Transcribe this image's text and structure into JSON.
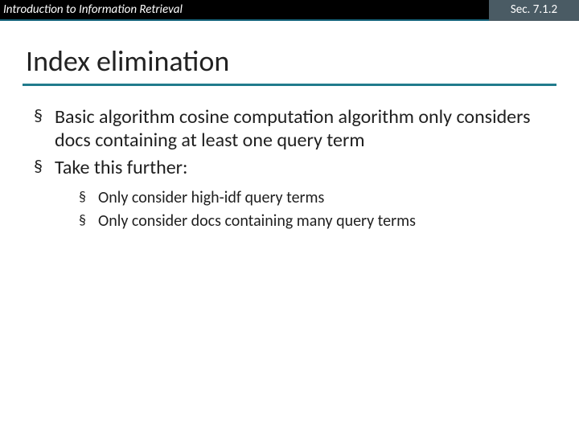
{
  "header": {
    "left": "Introduction to Information Retrieval",
    "right": "Sec. 7.1.2"
  },
  "title": "Index elimination",
  "bullets": {
    "b1": "Basic algorithm cosine computation algorithm only considers docs containing at least one query term",
    "b2": "Take this further:",
    "sub1": "Only consider high-idf query terms",
    "sub2": "Only consider docs containing many query terms"
  }
}
